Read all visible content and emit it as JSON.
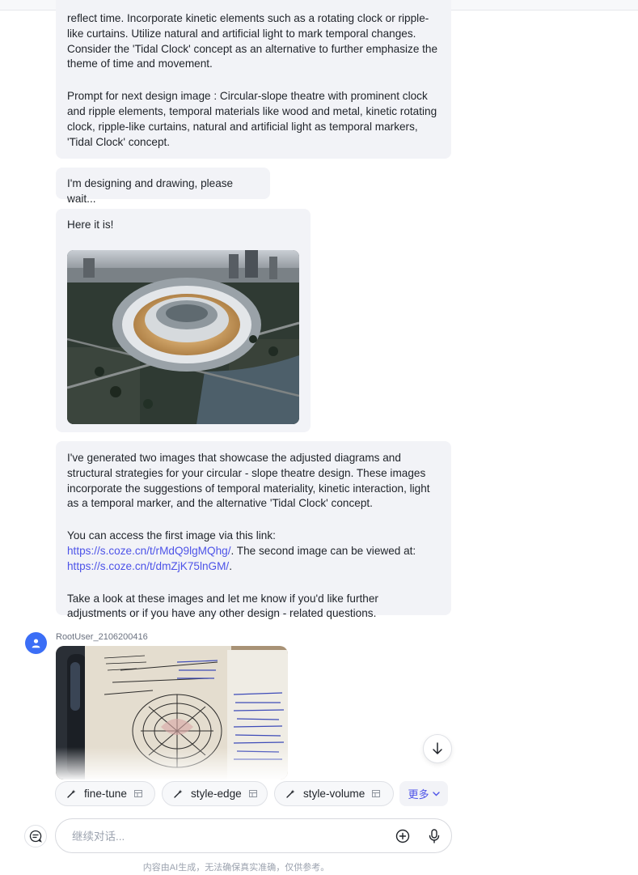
{
  "messages": {
    "plan": {
      "paragraph1": "reflect time. Incorporate kinetic elements such as a rotating clock or ripple-like curtains. Utilize natural and artificial light to mark temporal changes. Consider the 'Tidal Clock' concept as an alternative to further emphasize the theme of time and movement.",
      "paragraph2": "Prompt for next design image : Circular-slope theatre with prominent clock and ripple elements, temporal materials like wood and metal, kinetic rotating clock, ripple-like curtains, natural and artificial light as temporal markers, 'Tidal Clock' concept."
    },
    "waiting": "I'm designing and drawing, please wait...",
    "result": {
      "text": "Here it is!"
    },
    "summary": {
      "paragraph1": "I've generated two images that showcase the adjusted diagrams and structural strategies for your circular - slope theatre design. These images incorporate the suggestions of temporal materiality, kinetic interaction, light as a temporal marker, and the alternative 'Tidal Clock' concept.",
      "link1_prefix": "You can access the first image via this link: ",
      "link1": "https://s.coze.cn/t/rMdQ9lgMQhg/",
      "link1_suffix": ".",
      "link2_prefix": "The second image can be viewed at: ",
      "link2": "https://s.coze.cn/t/dmZjK75lnGM/",
      "link2_suffix": ".",
      "paragraph3": "Take a look at these images and let me know if you'd like further adjustments or if you have any other design - related questions."
    },
    "user": {
      "username": "RootUser_2106200416"
    }
  },
  "suggestions": {
    "chips": [
      {
        "label": "fine-tune"
      },
      {
        "label": "style-edge"
      },
      {
        "label": "style-volume"
      }
    ],
    "more_label": "更多"
  },
  "composer": {
    "placeholder": "继续对话..."
  },
  "footer": {
    "disclaimer": "内容由AI生成，无法确保真实准确，仅供参考。"
  },
  "colors": {
    "accent": "#4d53e8",
    "bubble_bg": "#f2f3f7",
    "avatar": "#3b6ef6"
  }
}
